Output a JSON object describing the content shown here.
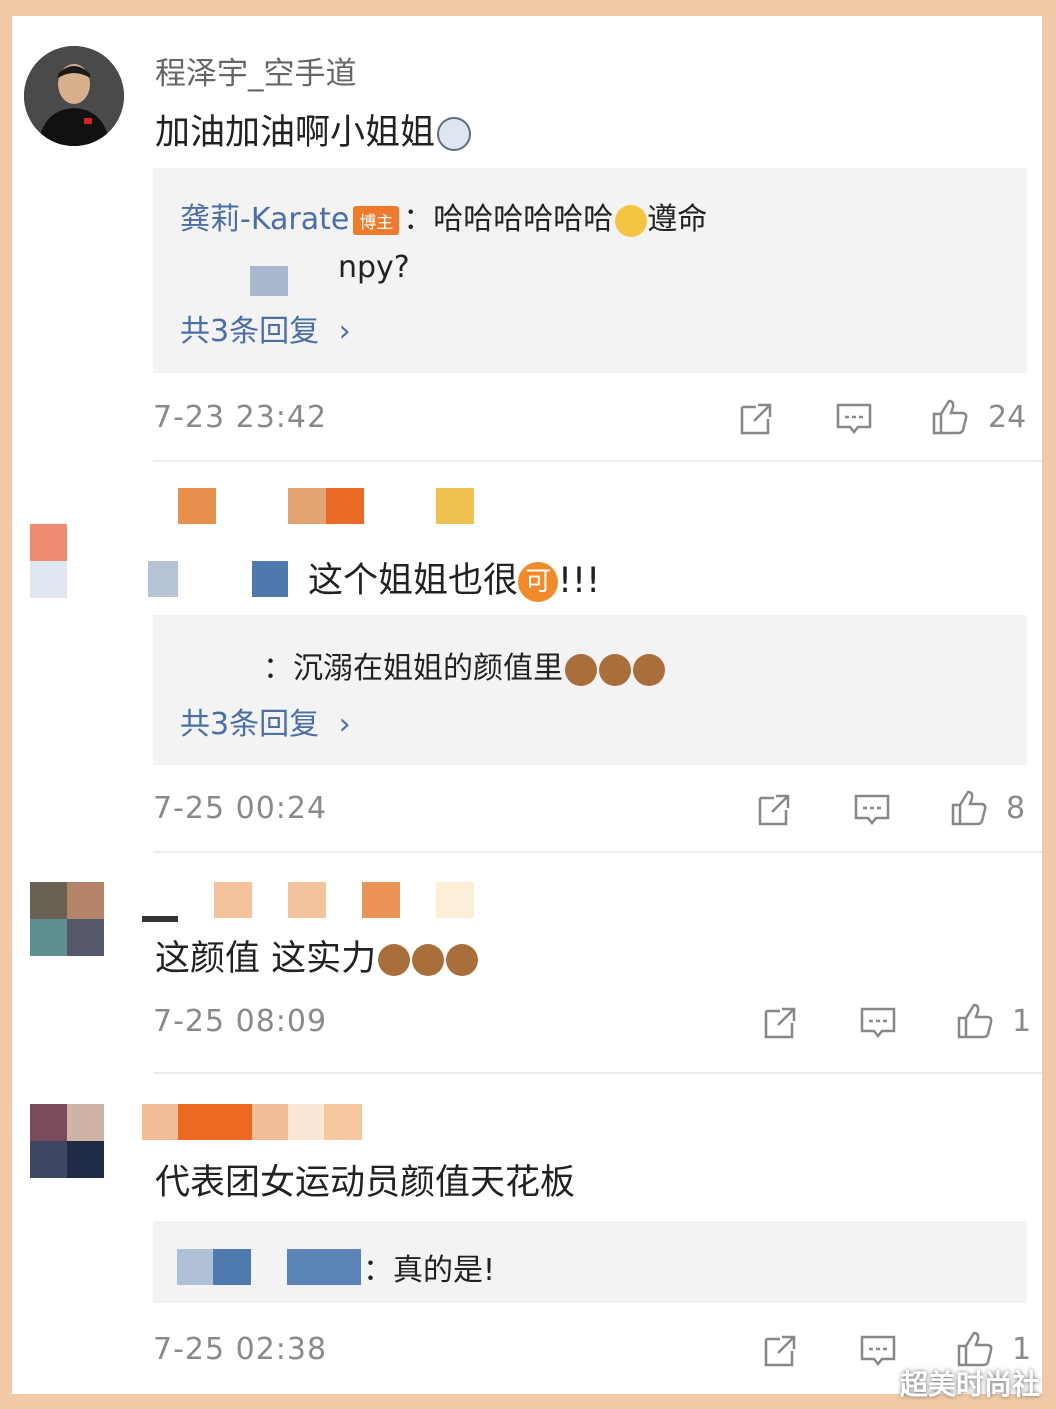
{
  "comments": [
    {
      "username": "程泽宇_空手道",
      "text": "加油加油啊小姐姐",
      "replies": [
        {
          "name": "龚莉-Karate",
          "badge": "博主",
          "text": "：哈哈哈哈哈哈",
          "suffix": "遵命"
        },
        {
          "text": "npy?"
        }
      ],
      "more_label": "共3条回复",
      "time": "7-23 23:42",
      "likes": "24"
    },
    {
      "username": "",
      "text": "这个姐姐也很",
      "text_suffix": "!!!",
      "badge_char": "可",
      "replies": [
        {
          "text": "：沉溺在姐姐的颜值里"
        }
      ],
      "more_label": "共3条回复",
      "time": "7-25 00:24",
      "likes": "8"
    },
    {
      "username": "",
      "text": "这颜值 这实力",
      "time": "7-25 08:09",
      "likes": "1"
    },
    {
      "username": "",
      "text": "代表团女运动员颜值天花板",
      "replies": [
        {
          "text": "：真的是!"
        }
      ],
      "time": "7-25 02:38",
      "likes": "1"
    }
  ],
  "watermark": "超美时尚社",
  "icons": {
    "share": "share-icon",
    "comment": "comment-icon",
    "like": "like-icon"
  },
  "colors": {
    "link": "#4b6ea5",
    "badge": "#f07a2c",
    "muted": "#8a8a8a"
  }
}
